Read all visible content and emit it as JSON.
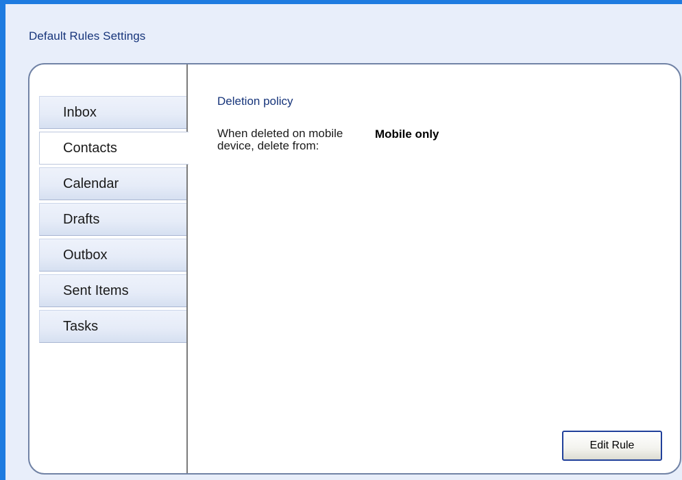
{
  "window": {
    "title": "Default Rules Settings"
  },
  "tabs": [
    {
      "label": "Inbox",
      "selected": false
    },
    {
      "label": "Contacts",
      "selected": true
    },
    {
      "label": "Calendar",
      "selected": false
    },
    {
      "label": "Drafts",
      "selected": false
    },
    {
      "label": "Outbox",
      "selected": false
    },
    {
      "label": "Sent Items",
      "selected": false
    },
    {
      "label": "Tasks",
      "selected": false
    }
  ],
  "content": {
    "section_title": "Deletion policy",
    "field_label": "When deleted on mobile device, delete from:",
    "field_value": "Mobile only",
    "edit_button_label": "Edit Rule"
  },
  "colors": {
    "window_border": "#1e7be0",
    "title_text": "#16347a",
    "background": "#e8eefa",
    "panel": "#ffffff",
    "button_border": "#1f3f9a"
  }
}
